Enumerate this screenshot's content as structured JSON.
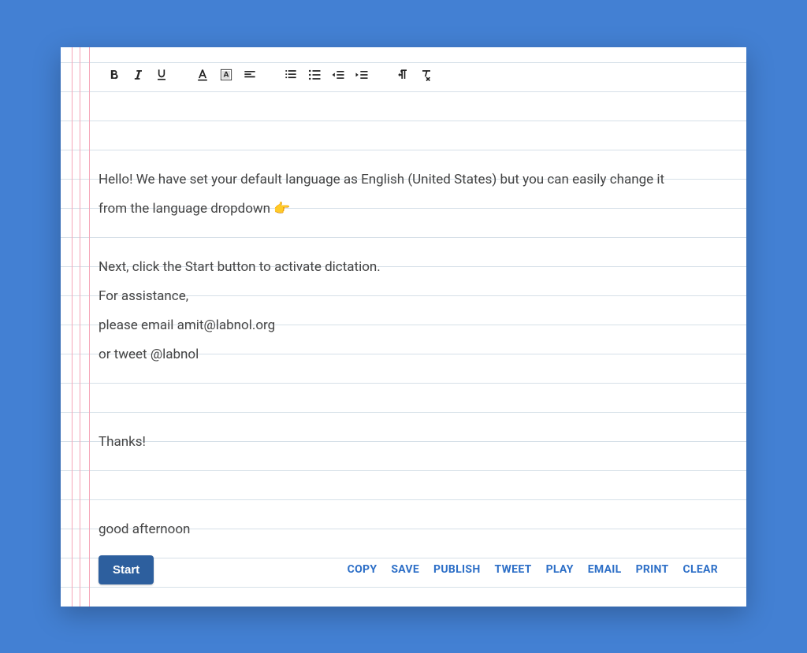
{
  "toolbar": {
    "bold": "bold-icon",
    "italic": "italic-icon",
    "underline": "underline-icon",
    "text_color": "text-color-icon",
    "highlight": "highlight-icon",
    "align": "align-icon",
    "list_numbered": "list-numbered-icon",
    "list_bulleted": "list-bulleted-icon",
    "outdent": "outdent-icon",
    "indent": "indent-icon",
    "direction": "direction-icon",
    "clear_format": "clear-format-icon"
  },
  "editor": {
    "lines": [
      " Hello!  We have set your default language as  English (United States) but you can easily change it",
      "from the language dropdown 👉",
      "",
      " Next, click the Start button to activate dictation.",
      " For assistance,",
      " please email amit@labnol.org",
      "  or tweet @labnol",
      "",
      "",
      " Thanks!",
      "",
      "",
      " good afternoon"
    ]
  },
  "buttons": {
    "start": "Start",
    "actions": [
      "COPY",
      "SAVE",
      "PUBLISH",
      "TWEET",
      "PLAY",
      "EMAIL",
      "PRINT",
      "CLEAR"
    ]
  }
}
